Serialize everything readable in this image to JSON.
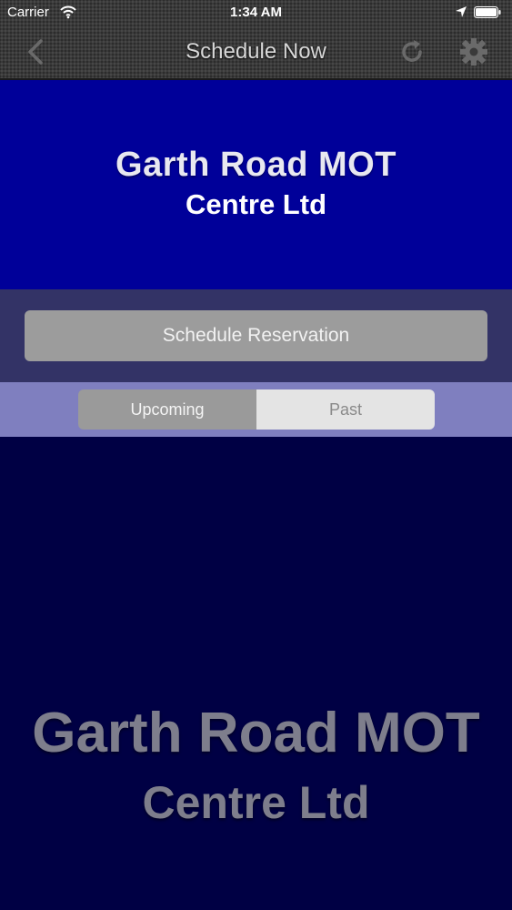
{
  "status_bar": {
    "carrier": "Carrier",
    "time": "1:34 AM"
  },
  "nav": {
    "title": "Schedule Now",
    "back_icon": "chevron-left-icon",
    "refresh_icon": "refresh-icon",
    "settings_icon": "gear-icon"
  },
  "banner": {
    "line1": "Garth Road MOT",
    "line2": "Centre Ltd"
  },
  "reservation": {
    "button_label": "Schedule Reservation"
  },
  "tabs": {
    "items": [
      {
        "label": "Upcoming",
        "selected": true
      },
      {
        "label": "Past",
        "selected": false
      }
    ]
  },
  "watermark": {
    "line1": "Garth Road MOT",
    "line2": "Centre Ltd"
  },
  "colors": {
    "banner": "#000099",
    "content": "#000044",
    "reserve_band": "#333366",
    "tab_band": "#7f7fbf"
  }
}
